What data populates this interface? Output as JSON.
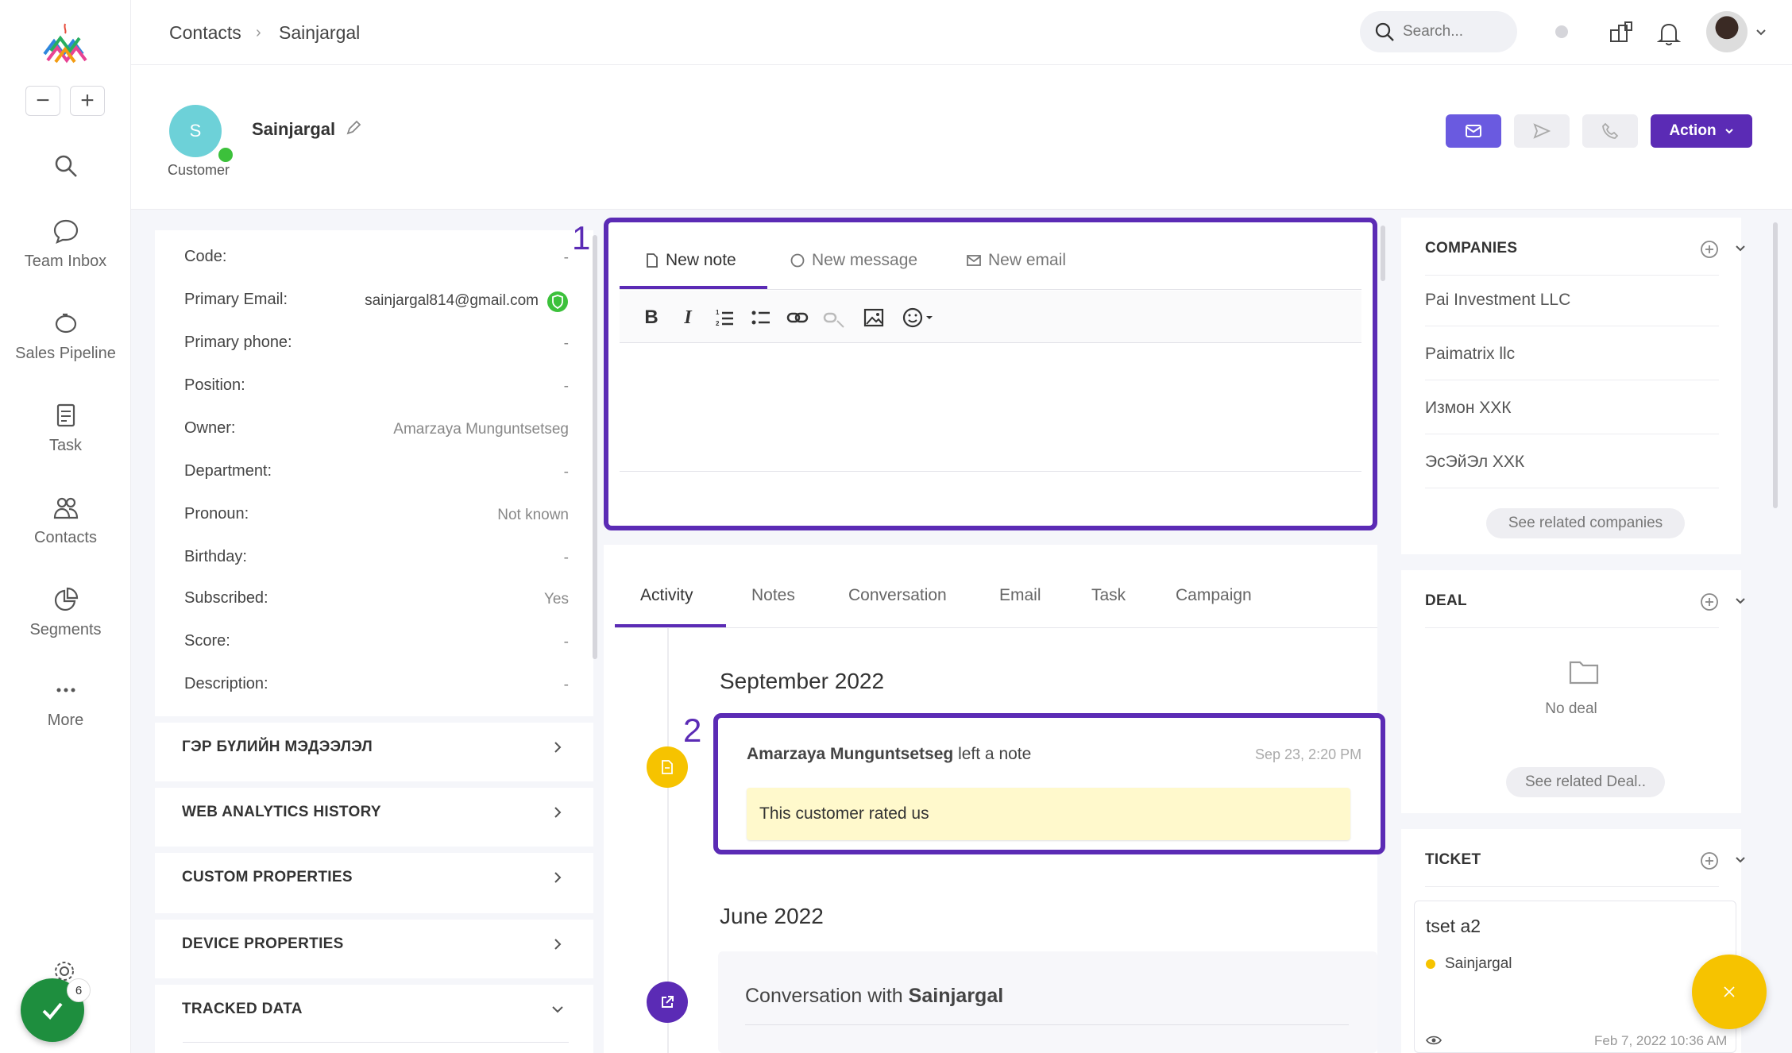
{
  "breadcrumb": {
    "root": "Contacts",
    "current": "Sainjargal"
  },
  "search": {
    "placeholder": "Search..."
  },
  "nav": {
    "items": [
      {
        "label": "Team Inbox"
      },
      {
        "label": "Sales Pipeline"
      },
      {
        "label": "Task"
      },
      {
        "label": "Contacts"
      },
      {
        "label": "Segments"
      },
      {
        "label": "More"
      }
    ],
    "badge": "6"
  },
  "contact": {
    "initial": "S",
    "name": "Sainjargal",
    "type": "Customer"
  },
  "header_actions": {
    "action_label": "Action"
  },
  "properties": [
    {
      "label": "Code:",
      "value": "-"
    },
    {
      "label": "Primary Email:",
      "value": "sainjargal814@gmail.com"
    },
    {
      "label": "Primary phone:",
      "value": "-"
    },
    {
      "label": "Position:",
      "value": "-"
    },
    {
      "label": "Owner:",
      "value": "Amarzaya Munguntsetseg"
    },
    {
      "label": "Department:",
      "value": "-"
    },
    {
      "label": "Pronoun:",
      "value": "Not known"
    },
    {
      "label": "Birthday:",
      "value": "-"
    },
    {
      "label": "Subscribed:",
      "value": "Yes"
    },
    {
      "label": "Score:",
      "value": "-"
    },
    {
      "label": "Description:",
      "value": "-"
    }
  ],
  "sections": [
    "ГЭР БҮЛИЙН МЭДЭЭЛЭЛ",
    "WEB ANALYTICS HISTORY",
    "CUSTOM PROPERTIES",
    "DEVICE PROPERTIES",
    "TRACKED DATA"
  ],
  "editor": {
    "tabs": [
      "New note",
      "New message",
      "New email"
    ],
    "annotation": "1"
  },
  "timeline": {
    "tabs": [
      "Activity",
      "Notes",
      "Conversation",
      "Email",
      "Task",
      "Campaign"
    ],
    "month1": "September 2022",
    "note": {
      "author": "Amarzaya Munguntsetseg",
      "action": "left a note",
      "time": "Sep 23, 2:20 PM",
      "text": "This customer rated us"
    },
    "annotation": "2",
    "month2": "June 2022",
    "conversation": {
      "prefix": "Conversation with",
      "name": "Sainjargal"
    }
  },
  "companies": {
    "title": "COMPANIES",
    "items": [
      "Pai Investment LLC",
      "Paimatrix llc",
      "Измон ХХК",
      "ЭсЭйЭл ХХК"
    ],
    "see_related": "See related companies"
  },
  "deal": {
    "title": "DEAL",
    "empty": "No deal",
    "see_related": "See related Deal.."
  },
  "ticket": {
    "title": "TICKET",
    "name": "tset a2",
    "assignee": "Sainjargal",
    "date": "Feb 7, 2022 10:36 AM"
  },
  "colors": {
    "primary": "#5b2bb5",
    "email_btn": "#6a5ae0",
    "online": "#3cc13b",
    "note_bg": "#fff9cc",
    "fab": "#f6c300"
  }
}
